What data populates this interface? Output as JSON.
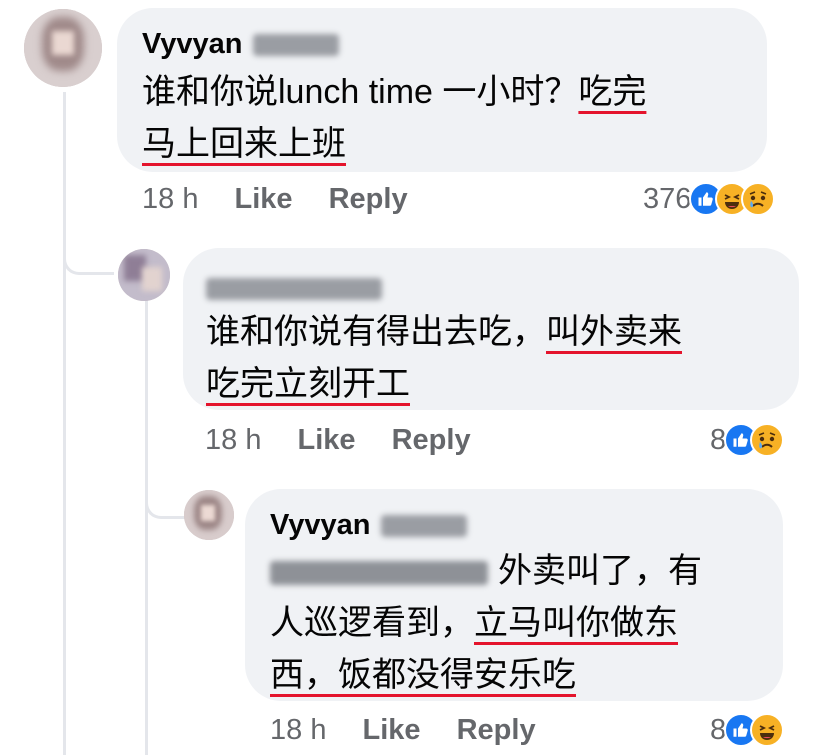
{
  "comments": [
    {
      "author": "Vyvyan",
      "lines": [
        [
          {
            "t": "谁和你说lunch time 一小时？",
            "u": false
          },
          {
            "t": "吃完",
            "u": true
          }
        ],
        [
          {
            "t": "马上回来上班",
            "u": true
          }
        ]
      ],
      "time": "18 h",
      "like": "Like",
      "reply": "Reply",
      "count": "376",
      "reactions": [
        "like-reaction-icon",
        "haha-reaction-icon",
        "sad-reaction-icon"
      ]
    },
    {
      "author": "",
      "lines": [
        [
          {
            "t": "谁和你说有得出去吃，",
            "u": false
          },
          {
            "t": "叫外卖来",
            "u": true
          }
        ],
        [
          {
            "t": "吃完立刻开工",
            "u": true
          }
        ]
      ],
      "time": "18 h",
      "like": "Like",
      "reply": "Reply",
      "count": "8",
      "reactions": [
        "like-reaction-icon",
        "sad-reaction-icon"
      ]
    },
    {
      "author": "Vyvyan",
      "lines": [
        [
          {
            "t": "外卖叫了，有",
            "u": false
          }
        ],
        [
          {
            "t": "人巡逻看到，",
            "u": false
          },
          {
            "t": "立马叫你做东",
            "u": true
          }
        ],
        [
          {
            "t": "西，饭都没得安乐吃",
            "u": true
          }
        ]
      ],
      "time": "18 h",
      "like": "Like",
      "reply": "Reply",
      "count": "8",
      "reactions": [
        "like-reaction-icon",
        "haha-reaction-icon"
      ]
    }
  ],
  "colors": {
    "bubble": "#f0f2f5",
    "underline": "#e4142c",
    "meta": "#65676b",
    "like_blue": "#1877f2",
    "emoji_yellow": "#f7b125"
  }
}
